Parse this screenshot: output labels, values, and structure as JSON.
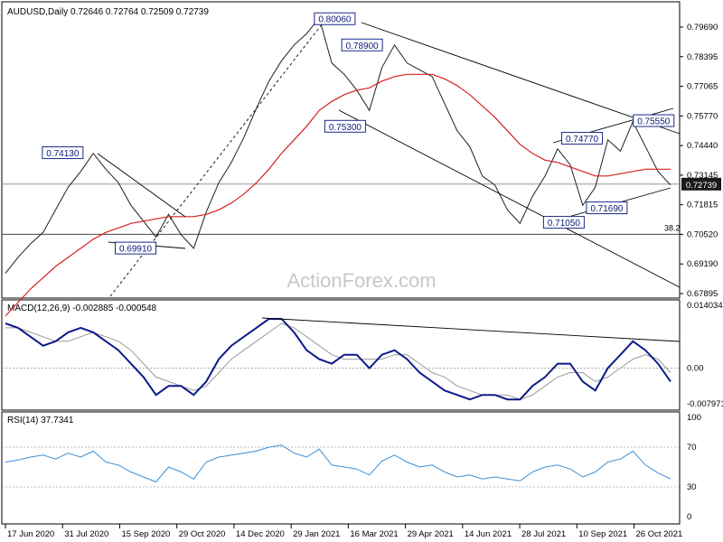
{
  "chart_data": [
    {
      "type": "line",
      "panel": "price",
      "title": "AUDUSD,Daily  0.72646 0.72764 0.72509 0.72739",
      "watermark": "ActionForex.com",
      "y_ticks": [
        "0.79690",
        "0.78395",
        "0.77065",
        "0.75770",
        "0.74440",
        "0.73145",
        "0.71815",
        "0.70520",
        "0.69190",
        "0.67895"
      ],
      "last_price_label": "0.72739",
      "fib_label": "38.2",
      "price_labels": [
        {
          "text": "0.80060",
          "x": "2021-02-25",
          "y": 0.8006
        },
        {
          "text": "0.78900",
          "x": "2021-03-18",
          "y": 0.789
        },
        {
          "text": "0.74130",
          "x": "2020-07-31",
          "y": 0.7413
        },
        {
          "text": "0.75300",
          "x": "2021-03-05",
          "y": 0.753
        },
        {
          "text": "0.69910",
          "x": "2020-09-25",
          "y": 0.6991
        },
        {
          "text": "0.71050",
          "x": "2021-08-20",
          "y": 0.7105
        },
        {
          "text": "0.71690",
          "x": "2021-09-22",
          "y": 0.7169
        },
        {
          "text": "0.74770",
          "x": "2021-09-03",
          "y": 0.7477
        },
        {
          "text": "0.75550",
          "x": "2021-10-28",
          "y": 0.7555
        }
      ],
      "series": [
        {
          "values": [
            0.688,
            0.695,
            0.701,
            0.706,
            0.716,
            0.726,
            0.733,
            0.741,
            0.734,
            0.728,
            0.718,
            0.711,
            0.704,
            0.714,
            0.705,
            0.699,
            0.715,
            0.728,
            0.737,
            0.748,
            0.761,
            0.773,
            0.782,
            0.789,
            0.794,
            0.801,
            0.781,
            0.776,
            0.769,
            0.76,
            0.779,
            0.789,
            0.781,
            0.778,
            0.775,
            0.763,
            0.751,
            0.744,
            0.731,
            0.727,
            0.716,
            0.71,
            0.722,
            0.731,
            0.743,
            0.736,
            0.718,
            0.726,
            0.747,
            0.742,
            0.755,
            0.744,
            0.733,
            0.727
          ]
        },
        {
          "values": [
            0.669,
            0.675,
            0.681,
            0.686,
            0.691,
            0.695,
            0.699,
            0.703,
            0.706,
            0.708,
            0.71,
            0.711,
            0.712,
            0.713,
            0.713,
            0.713,
            0.714,
            0.716,
            0.719,
            0.723,
            0.728,
            0.734,
            0.741,
            0.747,
            0.753,
            0.76,
            0.764,
            0.767,
            0.769,
            0.77,
            0.773,
            0.775,
            0.776,
            0.776,
            0.776,
            0.774,
            0.771,
            0.767,
            0.762,
            0.757,
            0.751,
            0.745,
            0.741,
            0.738,
            0.737,
            0.735,
            0.733,
            0.731,
            0.731,
            0.732,
            0.733,
            0.734,
            0.734,
            0.734
          ]
        }
      ]
    },
    {
      "type": "line",
      "panel": "macd",
      "title": "MACD(12,26,9) -0.002885 -0.000548",
      "y_ticks": [
        "0.014034",
        "0.00",
        "-0.007971"
      ],
      "series": [
        {
          "values": [
            0.01,
            0.009,
            0.007,
            0.005,
            0.006,
            0.008,
            0.009,
            0.008,
            0.006,
            0.004,
            0.001,
            -0.002,
            -0.006,
            -0.004,
            -0.004,
            -0.006,
            -0.003,
            0.002,
            0.005,
            0.007,
            0.009,
            0.011,
            0.011,
            0.008,
            0.004,
            0.002,
            0.001,
            0.003,
            0.003,
            0.0,
            0.003,
            0.004,
            0.002,
            -0.001,
            -0.003,
            -0.005,
            -0.006,
            -0.007,
            -0.006,
            -0.006,
            -0.007,
            -0.007,
            -0.004,
            -0.002,
            0.001,
            0.001,
            -0.003,
            -0.005,
            0.0,
            0.003,
            0.006,
            0.004,
            0.001,
            -0.003
          ]
        },
        {
          "values": [
            0.009,
            0.009,
            0.008,
            0.007,
            0.006,
            0.006,
            0.007,
            0.008,
            0.007,
            0.006,
            0.004,
            0.001,
            -0.002,
            -0.003,
            -0.004,
            -0.005,
            -0.004,
            -0.001,
            0.002,
            0.004,
            0.006,
            0.008,
            0.01,
            0.009,
            0.007,
            0.005,
            0.003,
            0.002,
            0.002,
            0.002,
            0.002,
            0.003,
            0.003,
            0.001,
            -0.001,
            -0.002,
            -0.004,
            -0.005,
            -0.006,
            -0.006,
            -0.006,
            -0.007,
            -0.006,
            -0.004,
            -0.002,
            -0.001,
            -0.001,
            -0.003,
            -0.002,
            0.0,
            0.002,
            0.003,
            0.002,
            -0.001
          ]
        }
      ]
    },
    {
      "type": "line",
      "panel": "rsi",
      "title": "RSI(14) 37.7341",
      "y_ticks": [
        "100",
        "70",
        "30",
        "0"
      ],
      "series": [
        {
          "values": [
            55,
            57,
            60,
            62,
            58,
            64,
            60,
            66,
            55,
            52,
            45,
            40,
            35,
            50,
            45,
            38,
            55,
            60,
            62,
            64,
            66,
            70,
            72,
            64,
            60,
            68,
            52,
            50,
            48,
            42,
            56,
            62,
            55,
            50,
            52,
            45,
            40,
            42,
            38,
            40,
            38,
            36,
            45,
            50,
            52,
            48,
            40,
            45,
            55,
            58,
            66,
            52,
            44,
            38
          ]
        }
      ]
    }
  ],
  "x_axis_labels": [
    "17 Jun 2020",
    "31 Jul 2020",
    "15 Sep 2020",
    "29 Oct 2020",
    "14 Dec 2020",
    "29 Jan 2021",
    "16 Mar 2021",
    "29 Apr 2021",
    "14 Jun 2021",
    "28 Jul 2021",
    "10 Sep 2021",
    "26 Oct 2021"
  ],
  "colors": {
    "price": "#1f1f1f",
    "ma": "#d62020",
    "macd": "#0d1a8a",
    "signal": "#9a9a9a",
    "rsi": "#3a8fd8",
    "label_border": "#1a2a8a",
    "label_text": "#0c1a7a",
    "watermark": "#c8c8c8"
  }
}
